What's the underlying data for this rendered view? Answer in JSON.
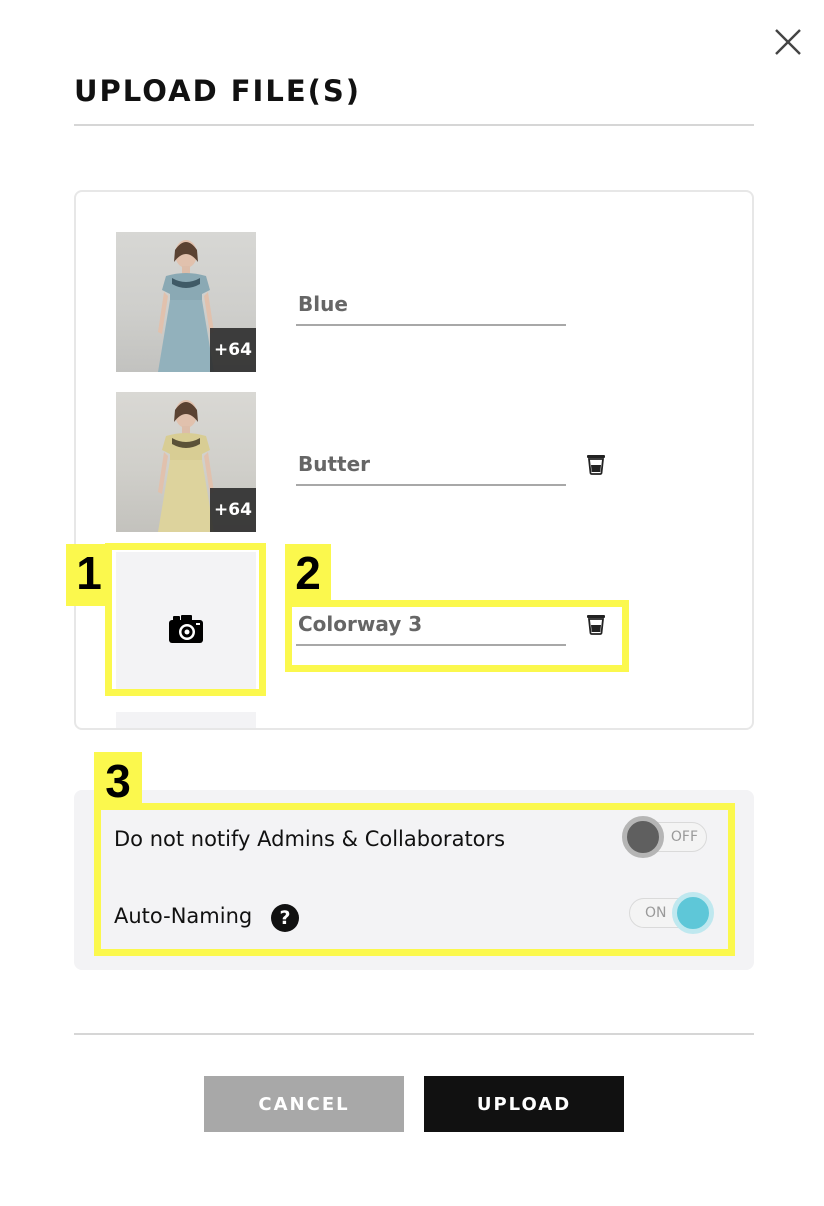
{
  "dialog": {
    "title": "UPLOAD FILE(S)",
    "close_icon": "close-icon"
  },
  "files": [
    {
      "name": "Blue",
      "image_count": "+64",
      "thumb": "dress-blue",
      "deletable": false
    },
    {
      "name": "Butter",
      "image_count": "+64",
      "thumb": "dress-butter",
      "deletable": true
    },
    {
      "name": "Colorway 3",
      "image_count": "",
      "thumb": "camera-icon",
      "deletable": true
    }
  ],
  "options": {
    "notify": {
      "label": "Do not notify Admins & Collaborators",
      "state": "OFF"
    },
    "auto_naming": {
      "label": "Auto-Naming",
      "help": "?",
      "state": "ON"
    }
  },
  "footer": {
    "cancel_label": "CANCEL",
    "upload_label": "UPLOAD"
  },
  "callouts": [
    "1",
    "2",
    "3"
  ],
  "colors": {
    "accent_on": "#5ec7d8",
    "highlight": "#fbf84d",
    "primary_button": "#111111",
    "secondary_button": "#a8a8a8"
  }
}
